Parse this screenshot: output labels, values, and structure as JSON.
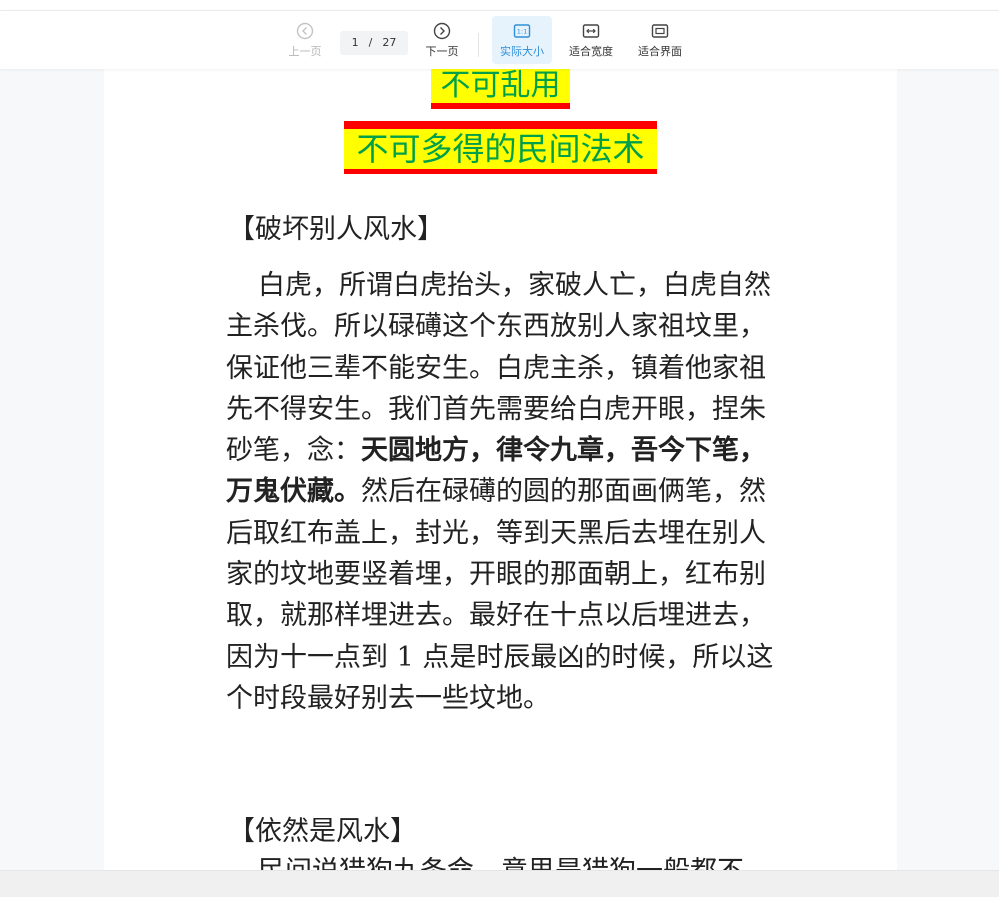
{
  "toolbar": {
    "prev_label": "上一页",
    "next_label": "下一页",
    "current_page": "1",
    "page_separator": "/",
    "total_pages": "27",
    "actual_size_label": "实际大小",
    "fit_width_label": "适合宽度",
    "fit_page_label": "适合界面",
    "active_mode": "actual_size",
    "accent_color": "#2e8fd8"
  },
  "document": {
    "title1": "不可乱用",
    "title2": "不可多得的民间法术",
    "title_text_color": "#00a04a",
    "title_highlight_color": "#ffff00",
    "title_bar_color": "#ff0000",
    "heading1": "【破坏别人风水】",
    "para1_before_bold": "白虎，所谓白虎抬头，家破人亡，白虎自然主杀伐。所以碌礡这个东西放别人家祖坟里，保证他三辈不能安生。白虎主杀，镇着他家祖先不得安生。我们首先需要给白虎开眼，捏朱砂笔，念：",
    "para1_bold": "天圆地方，律令九章，吾今下笔，万鬼伏藏。",
    "para1_after_bold": "然后在碌礡的圆的那面画俩笔，然后取红布盖上，封光，等到天黑后去埋在别人家的坟地要竖着埋，开眼的那面朝上，红布别取，就那样埋进去。最好在十点以后埋进去，因为十一点到 1 点是时辰最凶的时候，所以这个时段最好别去一些坟地。",
    "heading2": "【依然是风水】",
    "para2_partial": "民间说猎狗九条命，意思是猎狗一般都不"
  }
}
